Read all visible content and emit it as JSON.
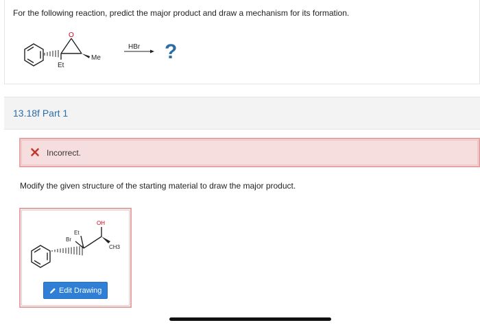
{
  "question": {
    "text": "For the following reaction, predict the major product and draw a mechanism for its formation.",
    "reaction": {
      "substituent_et": "Et",
      "substituent_me": "Me",
      "epoxide_o": "O",
      "reagent": "HBr",
      "product_placeholder": "?"
    }
  },
  "part": {
    "title": "13.18f Part 1"
  },
  "feedback": {
    "status": "Incorrect.",
    "icon": "x-icon",
    "color": "#c0392b"
  },
  "instruction": "Modify the given structure of the starting material to draw the major product.",
  "drawing": {
    "label_oh": "OH",
    "label_et": "Et",
    "label_br": "Br",
    "label_ch3": "CH3",
    "edit_button_label": "Edit Drawing",
    "edit_button_icon": "pencil-icon"
  },
  "colors": {
    "link_blue": "#2d6da6",
    "error_border": "#e5a3a3",
    "error_bg": "#f7dede",
    "button_blue": "#2f7fd6",
    "oxygen_red": "#d0021b"
  }
}
